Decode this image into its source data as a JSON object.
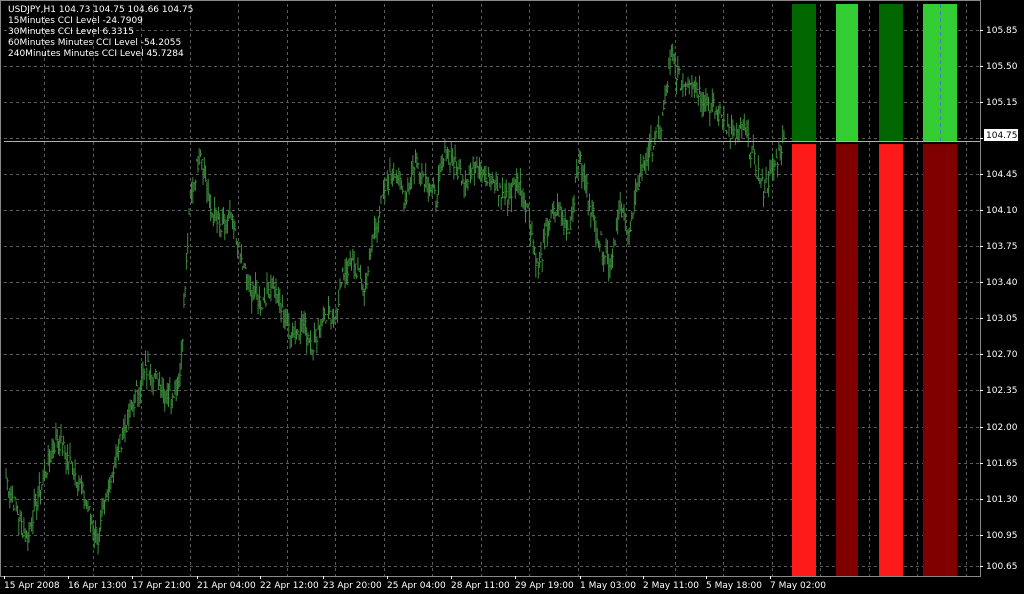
{
  "header": {
    "symbol_line": "USDJPY,H1  104.73 104.75 104.66 104.75",
    "indicators": [
      "15Minutes CCI Level -24.7909",
      "30Minutes CCI Level 6.3315",
      "60Minutes Minutes CCI Level -54.2055",
      "240Minutes Minutes CCI Level 45.7284"
    ]
  },
  "colors": {
    "background": "#000000",
    "grid": "#5a5a5a",
    "axis": "#ffffff",
    "price_line": "#b0b0b0",
    "bar_up": "#3c8c3c",
    "bright_green": "#33cc33",
    "dark_green": "#006600",
    "bright_red": "#ff1a1a",
    "dark_red": "#800000"
  },
  "chart_data": {
    "type": "line",
    "title": "USDJPY,H1",
    "ylim": [
      104.6,
      106.1
    ],
    "ylim_full": [
      100.6,
      106.1
    ],
    "y_ticks": [
      "105.85",
      "105.50",
      "105.15",
      "104.80",
      "104.45",
      "104.10",
      "103.75",
      "103.40",
      "103.05",
      "102.70",
      "102.35",
      "102.00",
      "101.65",
      "101.30",
      "100.95",
      "100.65"
    ],
    "x_ticks": [
      "15 Apr 2008",
      "16 Apr 13:00",
      "17 Apr 21:00",
      "21 Apr 04:00",
      "22 Apr 12:00",
      "23 Apr 20:00",
      "25 Apr 04:00",
      "28 Apr 11:00",
      "29 Apr 19:00",
      "1 May 03:00",
      "2 May 11:00",
      "5 May 18:00",
      "7 May 02:00"
    ],
    "current_price": "104.75",
    "series": [
      {
        "values": [
          101.5,
          101.2,
          100.9,
          101.3,
          101.6,
          101.9,
          101.7,
          101.5,
          101.2,
          100.9,
          101.4,
          101.8,
          102.1,
          102.4,
          102.6,
          102.4,
          102.3,
          102.5,
          104.2,
          104.7,
          104.1,
          103.9,
          104.0,
          103.6,
          103.3,
          103.2,
          103.4,
          103.1,
          102.9,
          103.0,
          102.8,
          103.1,
          103.0,
          103.5,
          103.6,
          103.3,
          103.9,
          104.3,
          104.5,
          104.2,
          104.6,
          104.4,
          104.2,
          104.7,
          104.5,
          104.4,
          104.6,
          104.4,
          104.3,
          104.2,
          104.4,
          104.1,
          103.5,
          104.0,
          104.1,
          103.9,
          104.6,
          104.2,
          103.8,
          103.6,
          104.1,
          103.9,
          104.5,
          104.7,
          104.9,
          105.6,
          105.3,
          105.4,
          105.2,
          105.1,
          105.0,
          104.8,
          104.9,
          104.6,
          104.3,
          104.5,
          104.8
        ]
      }
    ],
    "cci_bars": [
      {
        "label": "15Minutes",
        "value": -24.7909
      },
      {
        "label": "30Minutes",
        "value": 6.3315
      },
      {
        "label": "60Minutes",
        "value": -54.2055
      },
      {
        "label": "240Minutes",
        "value": 45.7284
      }
    ]
  }
}
